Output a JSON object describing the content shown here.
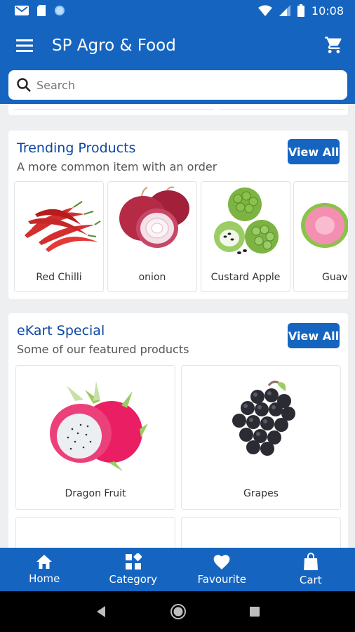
{
  "status": {
    "time": "10:08"
  },
  "appbar": {
    "title": "SP Agro & Food"
  },
  "search": {
    "placeholder": "Search"
  },
  "trending": {
    "title": "Trending Products",
    "subtitle": "A more common item with an order",
    "view_all": "View All",
    "items": [
      {
        "name": "Red Chilli"
      },
      {
        "name": "onion"
      },
      {
        "name": "Custard Apple"
      },
      {
        "name": "Guav"
      }
    ]
  },
  "special": {
    "title": "eKart Special",
    "subtitle": "Some of our featured products",
    "view_all": "View All",
    "items": [
      {
        "name": "Dragon Fruit"
      },
      {
        "name": "Grapes"
      }
    ]
  },
  "bottom_nav": [
    {
      "label": "Home",
      "icon": "home-icon"
    },
    {
      "label": "Category",
      "icon": "category-icon"
    },
    {
      "label": "Favourite",
      "icon": "heart-icon"
    },
    {
      "label": "Cart",
      "icon": "bag-icon"
    }
  ],
  "colors": {
    "primary": "#1565c0",
    "title": "#0d47a1",
    "background": "#eeeff1"
  }
}
